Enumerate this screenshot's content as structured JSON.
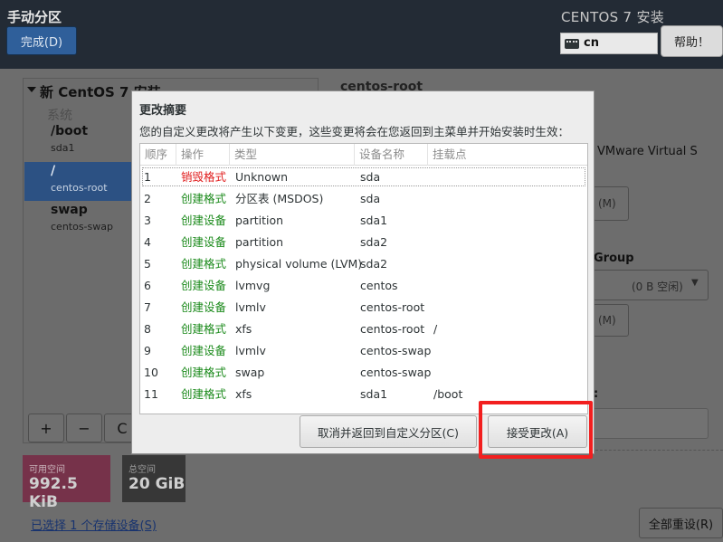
{
  "header": {
    "page_title": "手动分区",
    "done_label": "完成(D)",
    "os_title": "CENTOS 7 安装",
    "keyboard_layout": "cn",
    "help_label": "帮助！"
  },
  "left_panel": {
    "tree_title": "新 CentOS 7 安装",
    "system_label": "系统",
    "mounts": [
      {
        "name": "/boot",
        "device": "sda1"
      },
      {
        "name": "/",
        "device": "centos-root"
      },
      {
        "name": "swap",
        "device": "centos-swap"
      }
    ],
    "add_label": "+",
    "remove_label": "−",
    "refresh_label": "C"
  },
  "space": {
    "available_label": "可用空间",
    "available_value": "992.5 KiB",
    "total_label": "总空间",
    "total_value": "20 GiB"
  },
  "storage_link": "已选择 1 个存储设备(S)",
  "reset_label": "全部重设(R)",
  "right_panel": {
    "title": "centos-root",
    "device_model": "VMware Virtual S",
    "modify_label_1": "(M)",
    "volume_group_label": "Group",
    "volume_group_value": "(0 B 空闲)",
    "modify_label_2": "(M)",
    "colon": ":"
  },
  "dialog": {
    "title": "更改摘要",
    "description": "您的自定义更改将产生以下变更，这些变更将会在您返回到主菜单并开始安装时生效：",
    "columns": [
      "顺序",
      "操作",
      "类型",
      "设备名称",
      "挂载点"
    ],
    "rows": [
      {
        "order": "1",
        "action": "销毁格式",
        "action_kind": "destroy",
        "type": "Unknown",
        "device": "sda",
        "mount": ""
      },
      {
        "order": "2",
        "action": "创建格式",
        "action_kind": "create",
        "type": "分区表 (MSDOS)",
        "device": "sda",
        "mount": ""
      },
      {
        "order": "3",
        "action": "创建设备",
        "action_kind": "create",
        "type": "partition",
        "device": "sda1",
        "mount": ""
      },
      {
        "order": "4",
        "action": "创建设备",
        "action_kind": "create",
        "type": "partition",
        "device": "sda2",
        "mount": ""
      },
      {
        "order": "5",
        "action": "创建格式",
        "action_kind": "create",
        "type": "physical volume (LVM)",
        "device": "sda2",
        "mount": ""
      },
      {
        "order": "6",
        "action": "创建设备",
        "action_kind": "create",
        "type": "lvmvg",
        "device": "centos",
        "mount": ""
      },
      {
        "order": "7",
        "action": "创建设备",
        "action_kind": "create",
        "type": "lvmlv",
        "device": "centos-root",
        "mount": ""
      },
      {
        "order": "8",
        "action": "创建格式",
        "action_kind": "create",
        "type": "xfs",
        "device": "centos-root",
        "mount": "/"
      },
      {
        "order": "9",
        "action": "创建设备",
        "action_kind": "create",
        "type": "lvmlv",
        "device": "centos-swap",
        "mount": ""
      },
      {
        "order": "10",
        "action": "创建格式",
        "action_kind": "create",
        "type": "swap",
        "device": "centos-swap",
        "mount": ""
      },
      {
        "order": "11",
        "action": "创建格式",
        "action_kind": "create",
        "type": "xfs",
        "device": "sda1",
        "mount": "/boot"
      }
    ],
    "cancel_label": "取消并返回到自定义分区(C)",
    "accept_label": "接受更改(A)"
  },
  "colors": {
    "destroy": "#e01b1b",
    "create": "#1b8a1b",
    "highlight": "#f21f1f"
  }
}
